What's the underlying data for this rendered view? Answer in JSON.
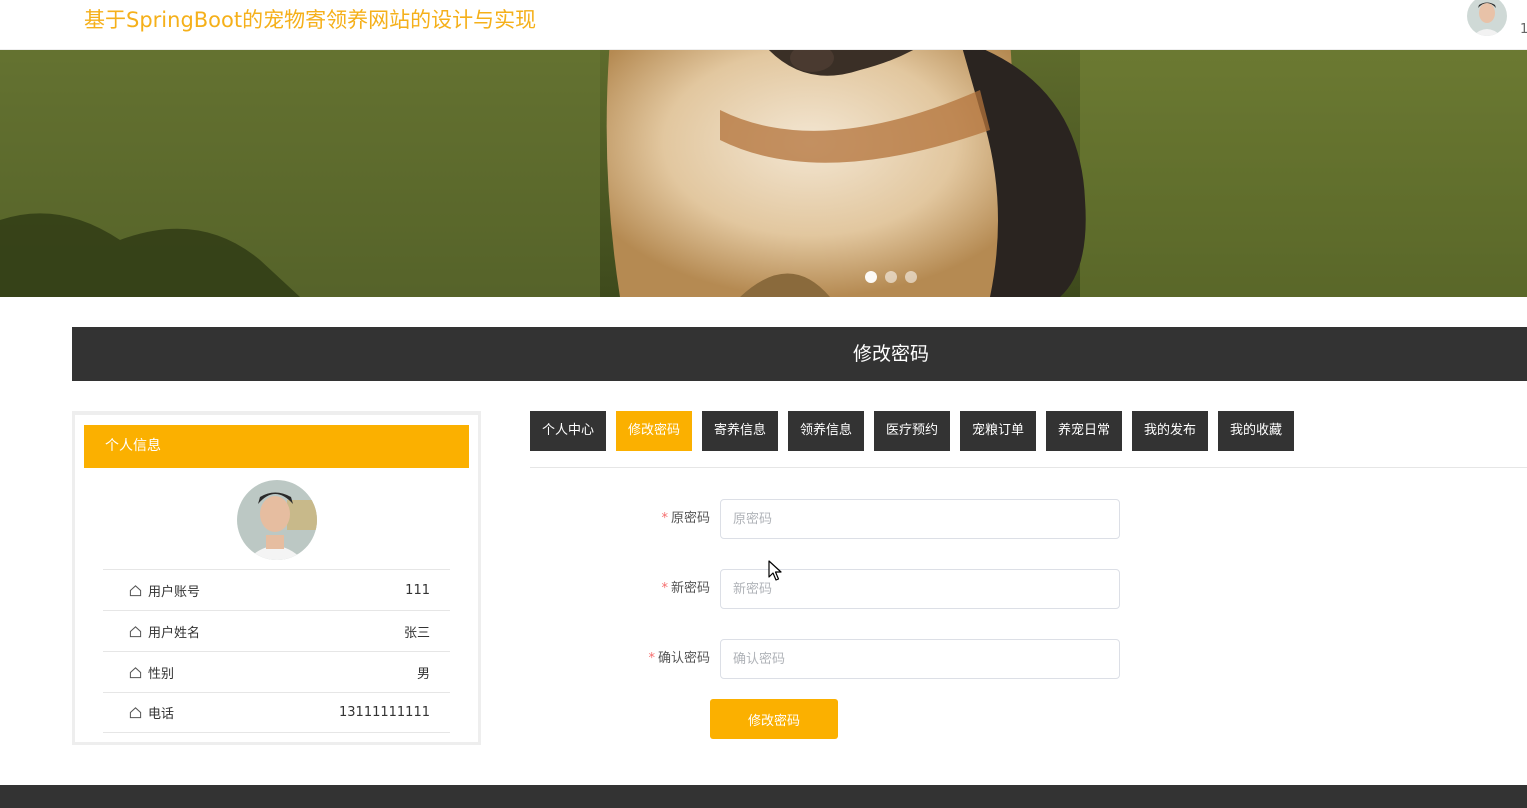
{
  "header": {
    "site_title": "基于SpringBoot的宠物寄领养网站的设计与实现",
    "user_count": "1"
  },
  "banner": {
    "slide_count": 3,
    "active_slide": 1
  },
  "section": {
    "title": "修改密码"
  },
  "profile": {
    "header": "个人信息",
    "fields": [
      {
        "label": "用户账号",
        "value": "111"
      },
      {
        "label": "用户姓名",
        "value": "张三"
      },
      {
        "label": "性别",
        "value": "男"
      },
      {
        "label": "电话",
        "value": "13111111111"
      }
    ]
  },
  "tabs": [
    {
      "label": "个人中心",
      "active": false
    },
    {
      "label": "修改密码",
      "active": true
    },
    {
      "label": "寄养信息",
      "active": false
    },
    {
      "label": "领养信息",
      "active": false
    },
    {
      "label": "医疗预约",
      "active": false
    },
    {
      "label": "宠粮订单",
      "active": false
    },
    {
      "label": "养宠日常",
      "active": false
    },
    {
      "label": "我的发布",
      "active": false
    },
    {
      "label": "我的收藏",
      "active": false
    }
  ],
  "form": {
    "old_password": {
      "label": "原密码",
      "placeholder": "原密码",
      "value": ""
    },
    "new_password": {
      "label": "新密码",
      "placeholder": "新密码",
      "value": ""
    },
    "confirm_password": {
      "label": "确认密码",
      "placeholder": "确认密码",
      "value": ""
    },
    "submit_label": "修改密码"
  },
  "colors": {
    "accent": "#fbb000",
    "title": "#f5b01a",
    "dark": "#333333",
    "required": "#f56c6c"
  }
}
